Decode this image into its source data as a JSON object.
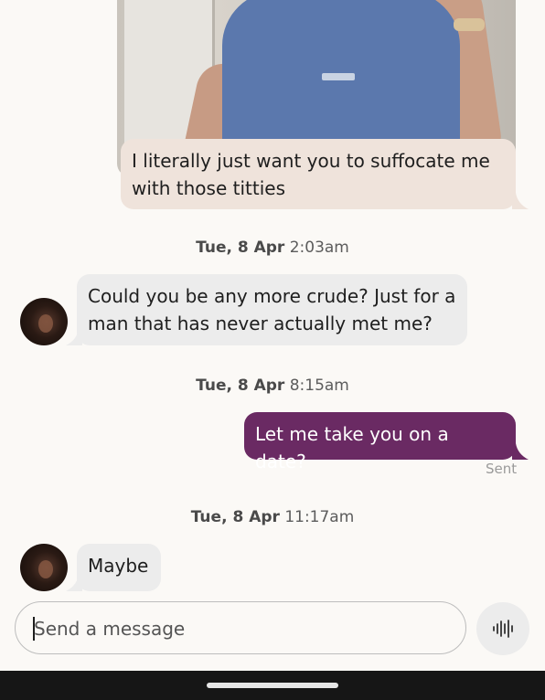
{
  "messages": [
    {
      "type": "image",
      "direction": "outgoing",
      "caption": "I literally just want you to suffocate me with those titties"
    },
    {
      "type": "timestamp",
      "day": "Tue, 8 Apr",
      "time": "2:03am"
    },
    {
      "type": "text",
      "direction": "incoming",
      "text": "Could you be any more crude? Just for a man that has never actually met me?"
    },
    {
      "type": "timestamp",
      "day": "Tue, 8 Apr",
      "time": "8:15am"
    },
    {
      "type": "text",
      "direction": "outgoing",
      "text": "Let me take you on a date?",
      "status": "Sent"
    },
    {
      "type": "timestamp",
      "day": "Tue, 8 Apr",
      "time": "11:17am"
    },
    {
      "type": "text",
      "direction": "incoming",
      "text": "Maybe"
    }
  ],
  "composer": {
    "placeholder": "Send a message",
    "value": ""
  },
  "icons": {
    "voice": "voice-waveform-icon",
    "avatar": "contact-avatar"
  },
  "colors": {
    "outgoing_bubble": "#6a2a63",
    "outgoing_caption_bubble": "#efe3db",
    "incoming_bubble": "#ececec",
    "background": "#fbf9f6"
  }
}
